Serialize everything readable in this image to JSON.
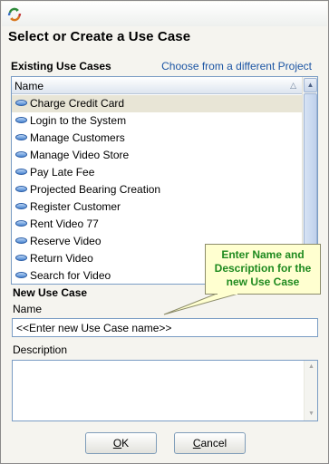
{
  "window": {
    "icon": "recycle-arrows-icon",
    "heading": "Select or Create a Use Case"
  },
  "existing": {
    "label": "Existing Use Cases",
    "link": "Choose from a different Project",
    "column_header": "Name",
    "sort_icon": "sort-triangle-icon",
    "item_icon": "use-case-oval-icon",
    "items": [
      "Charge Credit Card",
      "Login to the System",
      "Manage Customers",
      "Manage Video Store",
      "Pay Late Fee",
      "Projected Bearing Creation",
      "Register Customer",
      "Rent Video 77",
      "Reserve Video",
      "Return Video",
      "Search for Video"
    ],
    "selected_item": "Charge Credit Card"
  },
  "callout": {
    "text": "Enter Name and Description for the new Use Case"
  },
  "new_use_case": {
    "label": "New Use Case",
    "name_label": "Name",
    "name_value": "<<Enter new Use Case name>>",
    "description_label": "Description",
    "description_value": ""
  },
  "buttons": {
    "ok_mnemonic": "O",
    "ok_rest": "K",
    "cancel_mnemonic": "C",
    "cancel_rest": "ancel"
  },
  "colors": {
    "link": "#1c55a4",
    "callout_text": "#1f8a1f",
    "callout_bg": "#ffffd0",
    "selection_bg": "#e8e5d6"
  }
}
